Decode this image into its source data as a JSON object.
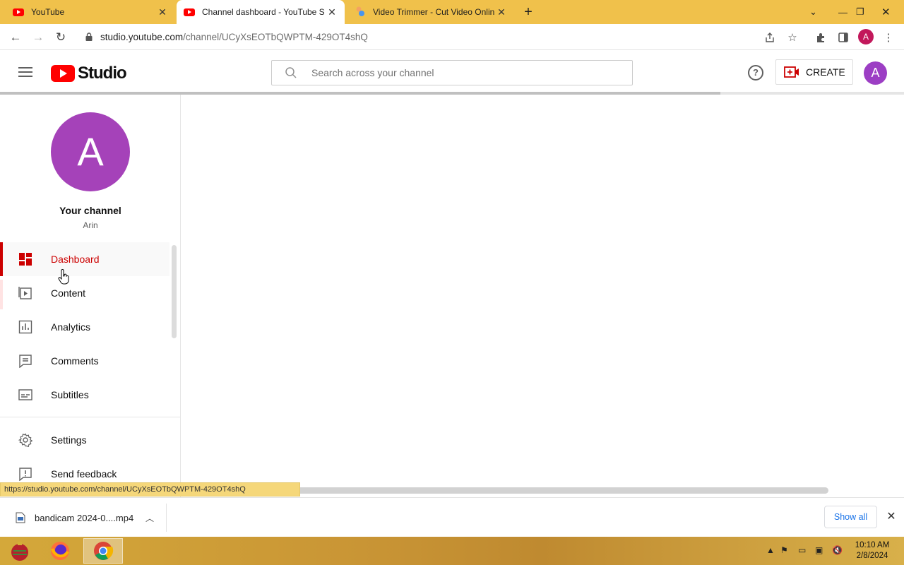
{
  "browser": {
    "tabs": [
      {
        "title": "YouTube",
        "icon": "youtube-icon",
        "active": false
      },
      {
        "title": "Channel dashboard - YouTube St",
        "icon": "youtube-icon",
        "active": true
      },
      {
        "title": "Video Trimmer - Cut Video Onlin",
        "icon": "video-trimmer-icon",
        "active": false
      }
    ],
    "address": {
      "host": "studio.youtube.com",
      "path": "/channel/UCyXsEOTbQWPTM-429OT4shQ"
    },
    "profile_initial": "A",
    "status_url": "https://studio.youtube.com/channel/UCyXsEOTbQWPTM-429OT4shQ"
  },
  "studio": {
    "logo_text": "Studio",
    "search_placeholder": "Search across your channel",
    "create_label": "CREATE",
    "avatar_initial": "A"
  },
  "sidebar": {
    "channel_initial": "A",
    "channel_title": "Your channel",
    "channel_name": "Arin",
    "items": [
      {
        "label": "Dashboard",
        "icon": "dashboard-icon",
        "active": true
      },
      {
        "label": "Content",
        "icon": "content-icon",
        "active": false
      },
      {
        "label": "Analytics",
        "icon": "analytics-icon",
        "active": false
      },
      {
        "label": "Comments",
        "icon": "comments-icon",
        "active": false
      },
      {
        "label": "Subtitles",
        "icon": "subtitles-icon",
        "active": false
      }
    ],
    "bottom_items": [
      {
        "label": "Settings",
        "icon": "settings-icon"
      },
      {
        "label": "Send feedback",
        "icon": "feedback-icon"
      }
    ]
  },
  "downloads": {
    "file_name": "bandicam 2024-0....mp4",
    "show_all_label": "Show all"
  },
  "taskbar": {
    "time": "10:10 AM",
    "date": "2/8/2024"
  },
  "colors": {
    "accent_red": "#cc0000",
    "youtube_red": "#ff0000",
    "avatar_purple": "#a542b9",
    "tabstrip_yellow": "#f0c14b"
  }
}
